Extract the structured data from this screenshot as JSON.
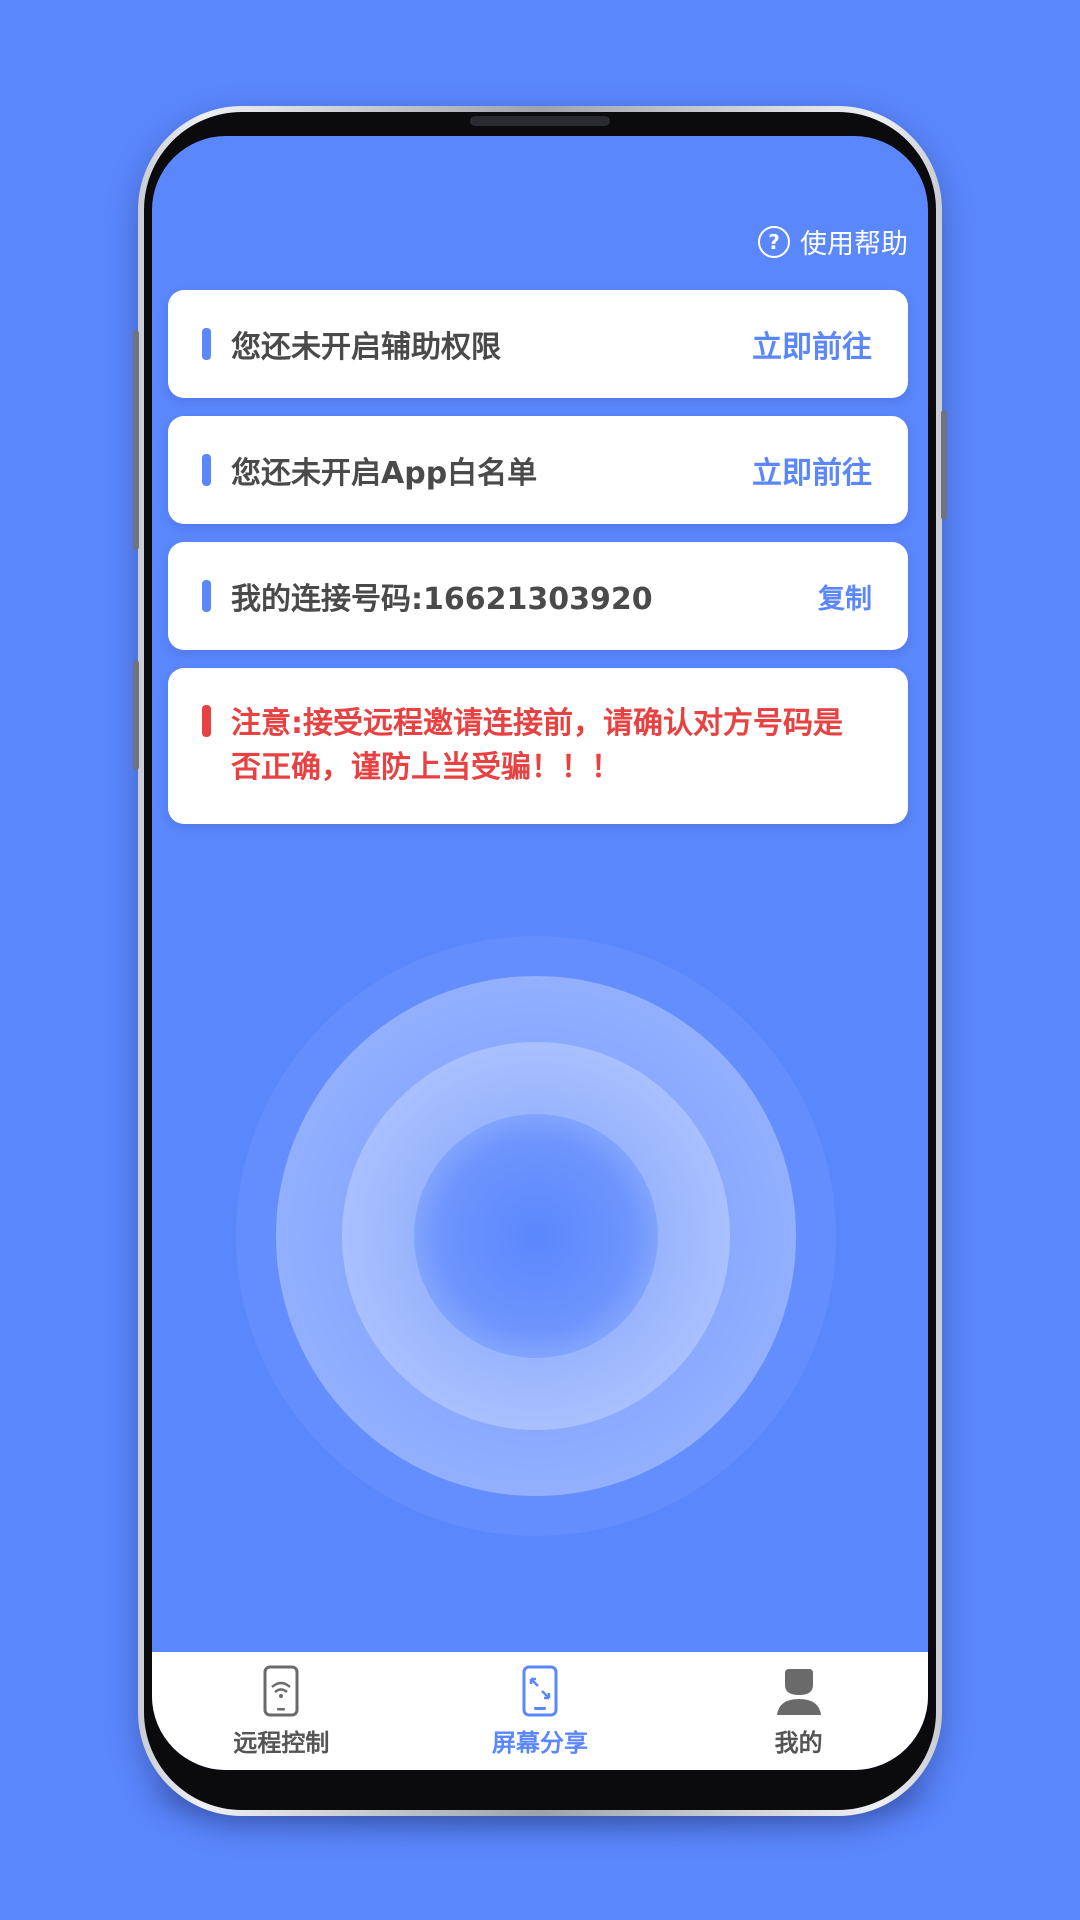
{
  "colors": {
    "background": "#5b87fd",
    "accent": "#5b87fd",
    "warning": "#e84141",
    "text": "#4a4a4a",
    "nav_inactive": "#555555"
  },
  "header": {
    "help_icon": "question-circle-icon",
    "help_label": "使用帮助"
  },
  "cards": [
    {
      "text": "您还未开启辅助权限",
      "action": "立即前往"
    },
    {
      "text": "您还未开启App白名单",
      "action": "立即前往"
    },
    {
      "text": "我的连接号码:16621303920",
      "action": "复制"
    }
  ],
  "warning": {
    "text": "注意:接受远程邀请连接前，请确认对方号码是否正确，谨防上当受骗！！！"
  },
  "bottom_nav": {
    "active_index": 1,
    "items": [
      {
        "label": "远程控制",
        "icon": "phone-wifi-icon"
      },
      {
        "label": "屏幕分享",
        "icon": "screen-share-icon"
      },
      {
        "label": "我的",
        "icon": "user-icon"
      }
    ]
  }
}
